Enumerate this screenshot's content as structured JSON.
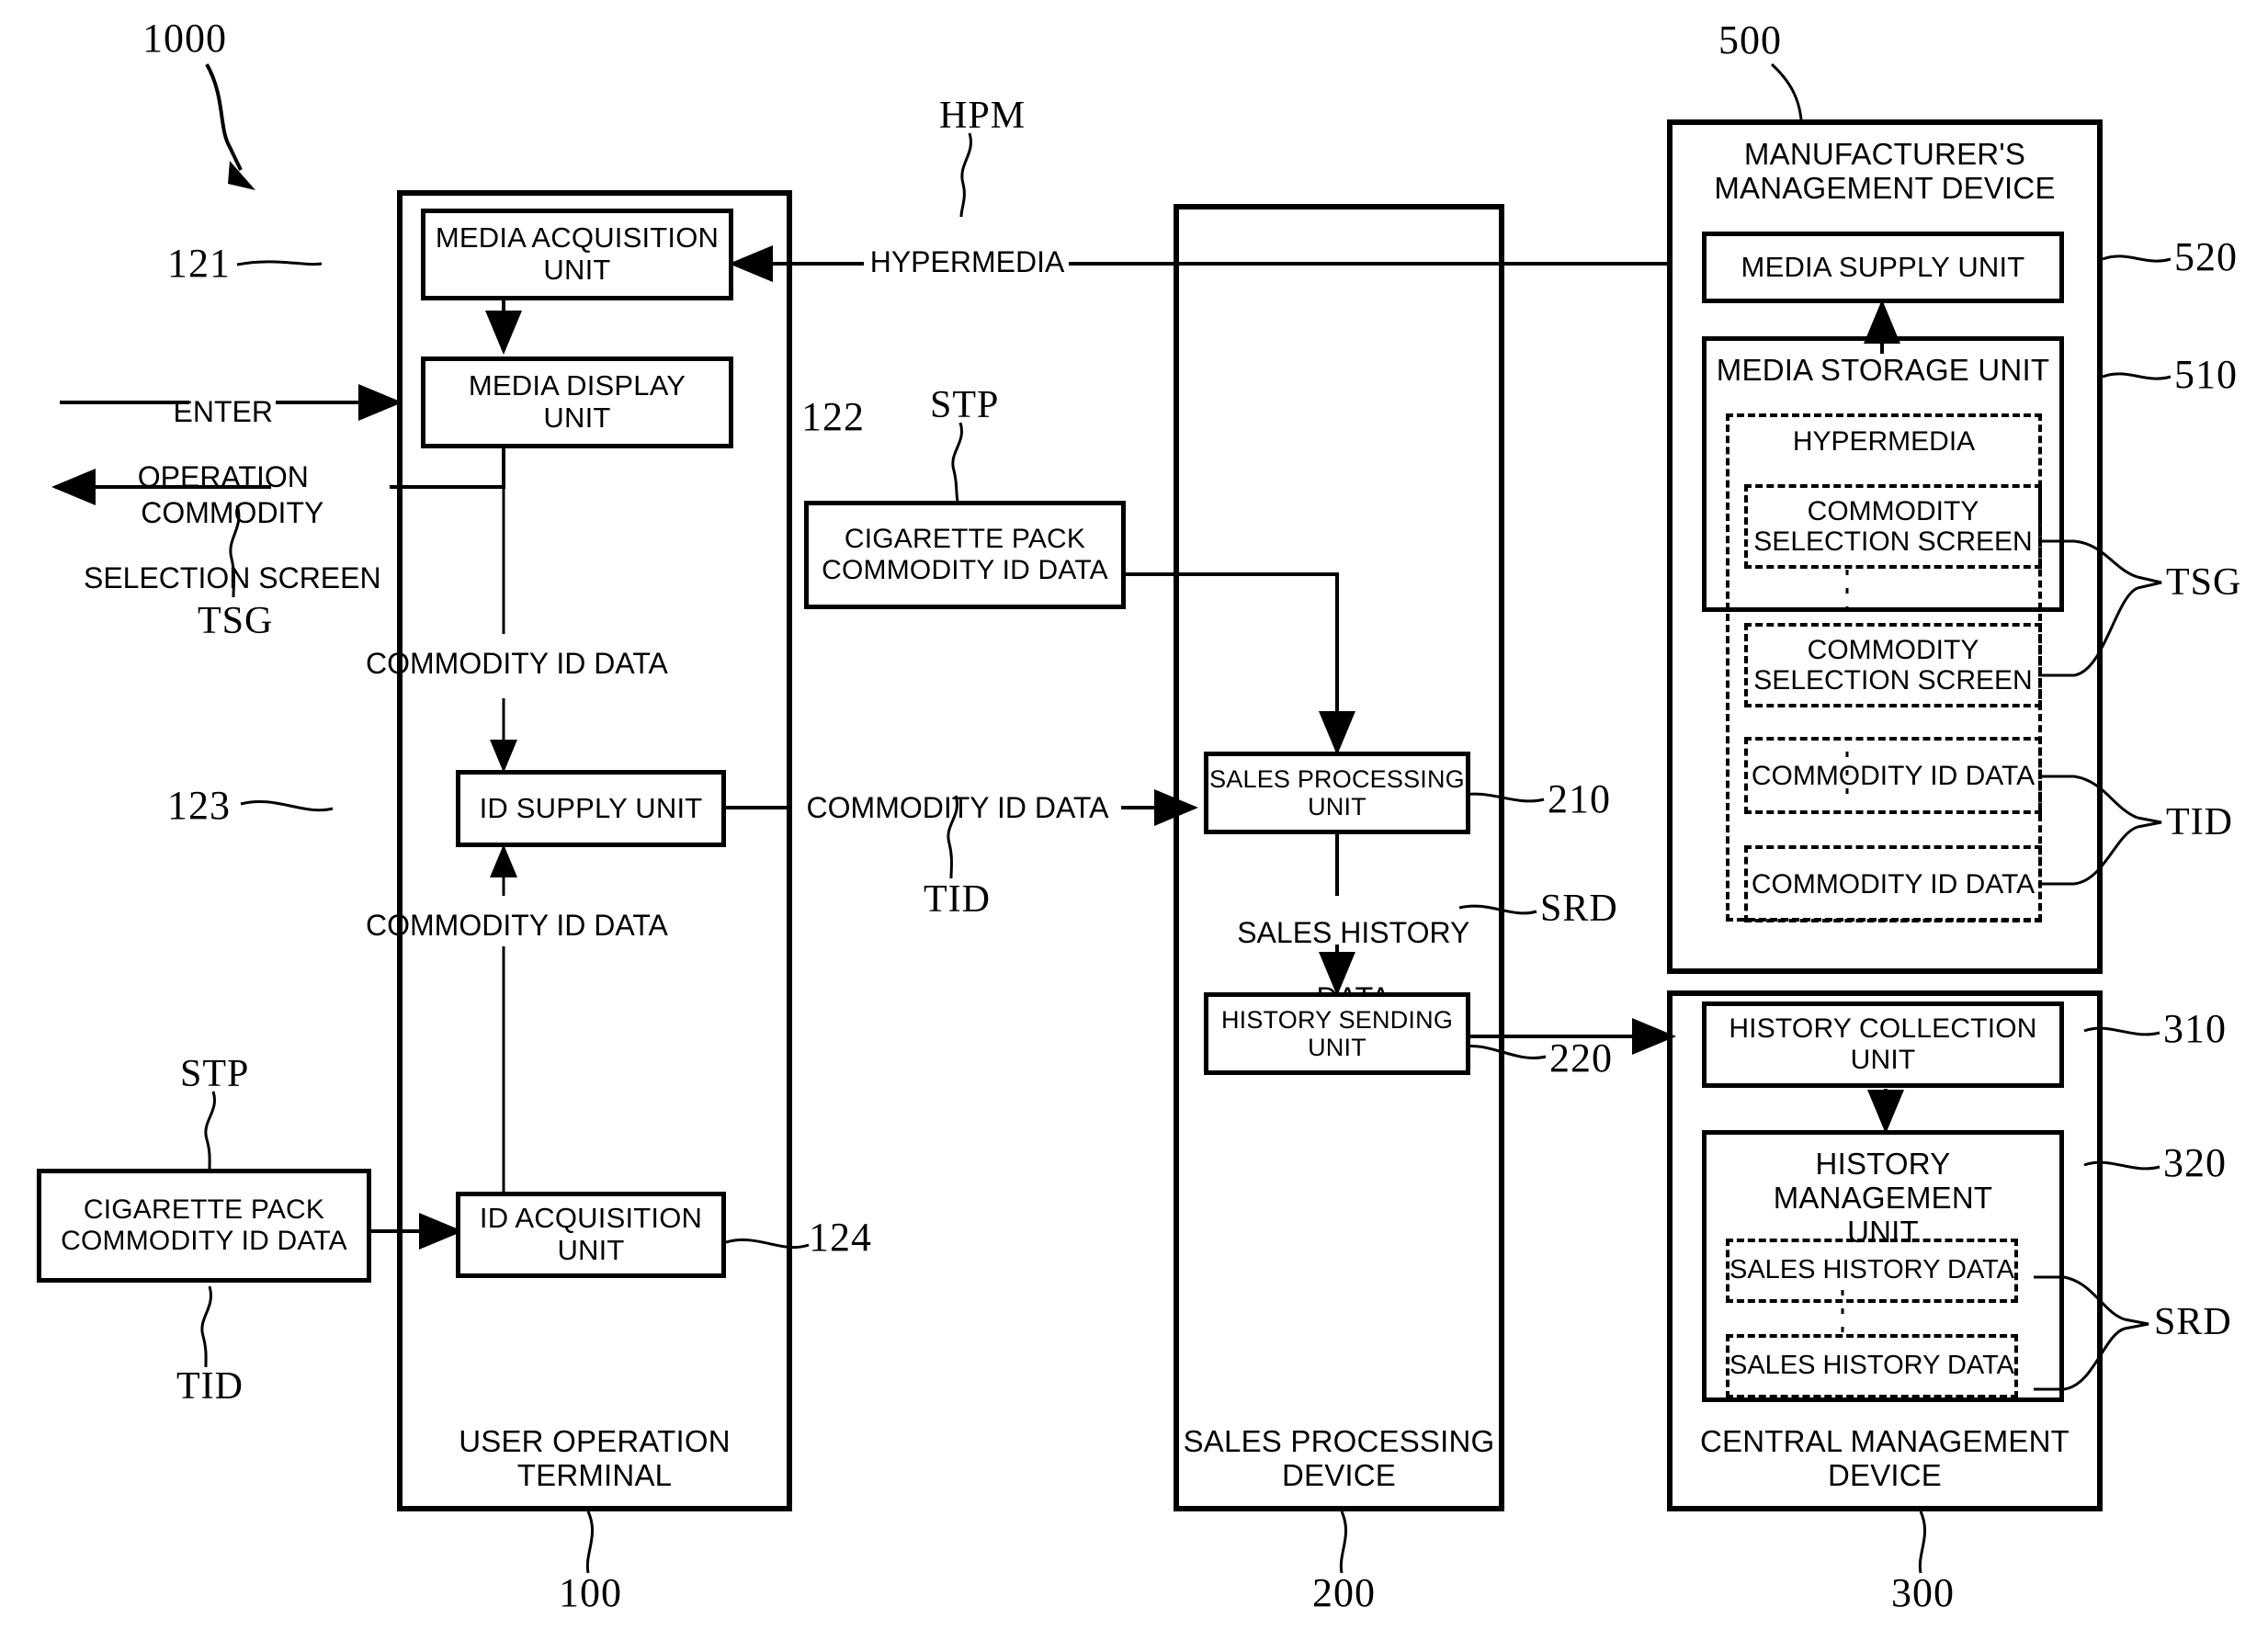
{
  "figure": {
    "system_ref": "1000"
  },
  "terminal": {
    "ref": "100",
    "title_line1": "USER OPERATION",
    "title_line2": "TERMINAL",
    "units": [
      {
        "ref": "121",
        "line1": "MEDIA ACQUISITION",
        "line2": "UNIT"
      },
      {
        "ref": "122",
        "line1": "MEDIA DISPLAY",
        "line2": "UNIT"
      },
      {
        "ref": "123",
        "line1": "ID SUPPLY UNIT",
        "line2": ""
      },
      {
        "ref": "124",
        "line1": "ID ACQUISITION",
        "line2": "UNIT"
      }
    ],
    "internal_flows": [
      "COMMODITY ID DATA",
      "COMMODITY ID DATA"
    ]
  },
  "external_left": {
    "enter_operation_line1": "ENTER",
    "enter_operation_line2": "OPERATION",
    "selection_screen_line1": "COMMODITY",
    "selection_screen_line2": "SELECTION SCREEN",
    "selection_screen_code": "TSG",
    "cigarette_pack_line1": "CIGARETTE PACK",
    "cigarette_pack_line2": "COMMODITY ID DATA",
    "cigarette_pack_code_top": "STP",
    "cigarette_pack_code_bottom": "TID"
  },
  "middle": {
    "hypermedia_label": "HYPERMEDIA",
    "hypermedia_code": "HPM",
    "commodity_id_label": "COMMODITY ID DATA",
    "commodity_id_code": "TID",
    "cigarette_pack_line1": "CIGARETTE PACK",
    "cigarette_pack_line2": "COMMODITY ID DATA",
    "cigarette_pack_code": "STP"
  },
  "sales_device": {
    "ref": "200",
    "title_line1": "SALES PROCESSING",
    "title_line2": "DEVICE",
    "units": [
      {
        "ref": "210",
        "line1": "SALES PROCESSING",
        "line2": "UNIT"
      },
      {
        "ref": "220",
        "line1": "HISTORY SENDING",
        "line2": "UNIT"
      }
    ],
    "flow_line1": "SALES HISTORY",
    "flow_line2": "DATA",
    "flow_code": "SRD"
  },
  "manufacturer": {
    "ref": "500",
    "title_line1": "MANUFACTURER'S",
    "title_line2": "MANAGEMENT DEVICE",
    "media_supply_unit": {
      "ref": "520",
      "label": "MEDIA SUPPLY UNIT"
    },
    "media_storage_unit": {
      "ref": "510",
      "label": "MEDIA STORAGE UNIT"
    },
    "hypermedia_label": "HYPERMEDIA",
    "contents": [
      {
        "line1": "COMMODITY",
        "line2": "SELECTION SCREEN"
      },
      {
        "line1": "COMMODITY",
        "line2": "SELECTION SCREEN"
      },
      {
        "line1": "COMMODITY ID DATA",
        "line2": ""
      },
      {
        "line1": "COMMODITY ID DATA",
        "line2": ""
      }
    ],
    "screen_code": "TSG",
    "id_code": "TID"
  },
  "central": {
    "ref": "300",
    "title_line1": "CENTRAL MANAGEMENT",
    "title_line2": "DEVICE",
    "history_collection_unit": {
      "ref": "310",
      "line1": "HISTORY COLLECTION",
      "line2": "UNIT"
    },
    "history_management_unit": {
      "ref": "320",
      "line1": "HISTORY MANAGEMENT",
      "line2": "UNIT"
    },
    "records": [
      "SALES HISTORY DATA",
      "SALES HISTORY DATA"
    ],
    "records_code": "SRD"
  }
}
